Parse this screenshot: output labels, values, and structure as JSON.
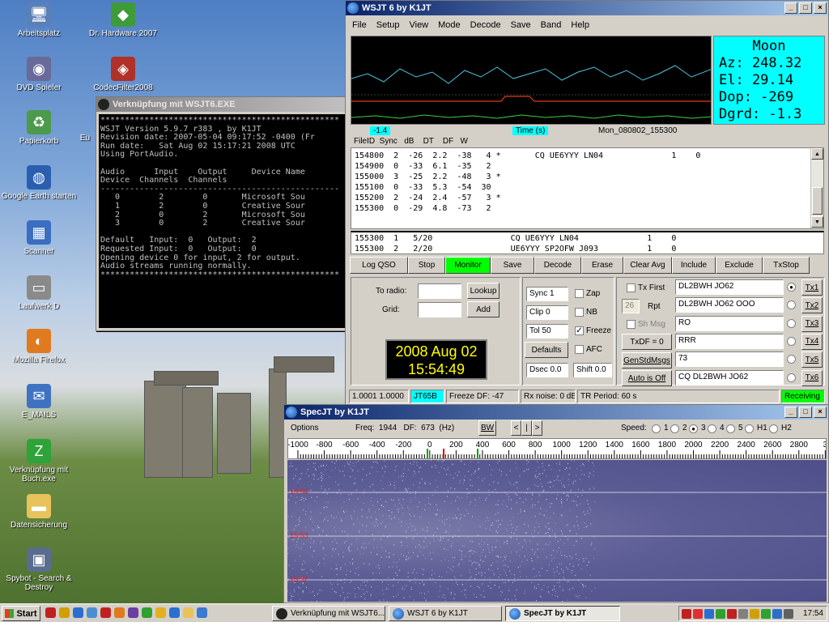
{
  "desktop_icons": [
    {
      "label": "Arbeitsplatz",
      "glyph": "🖥",
      "color": "#5b7fb8"
    },
    {
      "label": "DVD Spieler",
      "glyph": "◉",
      "color": "#6a6a9a"
    },
    {
      "label": "Papierkorb",
      "glyph": "♻",
      "color": "#4c9a4c"
    },
    {
      "label": "Google Earth starten",
      "glyph": "◍",
      "color": "#2a5fb0"
    },
    {
      "label": "Scanner",
      "glyph": "▦",
      "color": "#3b6dc0"
    },
    {
      "label": "Laufwerk D",
      "glyph": "▭",
      "color": "#8a8a8a"
    },
    {
      "label": "Mozilla Firefox",
      "glyph": "◐",
      "color": "#e07a1f"
    },
    {
      "label": "E_MAILS",
      "glyph": "✉",
      "color": "#3f73c2"
    },
    {
      "label": "Verknüpfung mit Buch.exe",
      "glyph": "Z",
      "color": "#2da33a"
    },
    {
      "label": "Datensicherung",
      "glyph": "▬",
      "color": "#e8c25a"
    },
    {
      "label": "Spybot - Search & Destroy",
      "glyph": "▣",
      "color": "#5a6d8e"
    },
    {
      "label": "Dr. Hardware 2007",
      "glyph": "◆",
      "color": "#3f9a3a"
    },
    {
      "label": "CodecFilter2008",
      "glyph": "◈",
      "color": "#b0302a"
    },
    {
      "label": "Eu",
      "glyph": "",
      "color": "transparent"
    }
  ],
  "console": {
    "title": "Verknüpfung mit WSJT6.EXE",
    "lines": [
      "*************************************************",
      "WSJT Version 5.9.7 r383 , by K1JT",
      "Revision date: 2007-05-04 09:17:52 -0400 (Fr",
      "Run date:   Sat Aug 02 15:17:21 2008 UTC",
      "Using PortAudio.",
      "",
      "Audio      Input    Output     Device Name",
      "Device  Channels  Channels",
      "-------------------------------------------------",
      "   0        2        0       Microsoft Sou",
      "   1        2        0       Creative Sour",
      "   2        0        2       Microsoft Sou",
      "   3        0        2       Creative Sour",
      "",
      "Default   Input:  0   Output:  2",
      "Requested Input:  0   Output:  0",
      "Opening device 0 for input, 2 for output.",
      "Audio streams running normally.",
      "*************************************************"
    ]
  },
  "wsjt": {
    "title": "WSJT 6    by K1JT",
    "menu": [
      "File",
      "Setup",
      "View",
      "Mode",
      "Decode",
      "Save",
      "Band",
      "Help"
    ],
    "moon": {
      "title": "Moon",
      "az": "Az: 248.32",
      "el": "El:  29.14",
      "dop": "Dop:  -269",
      "dgrd": "Dgrd: -1.3"
    },
    "graph_labels": {
      "left": "-1.4",
      "center": "Time (s)",
      "right": "Mon_080802_155300"
    },
    "columns": "FileID  Sync   dB    DT    DF   W",
    "rows": [
      "154800  2  -26  2.2  -38   4 *       CQ UE6YYY LN04              1    0",
      "154900  0  -33  6.1  -35   2",
      "155000  3  -25  2.2  -48   3 *",
      "155100  0  -33  5.3  -54  30",
      "155200  2  -24  2.4  -57   3 *",
      "155300  0  -29  4.8  -73   2"
    ],
    "avg_rows": [
      "155300  1   5/20                CQ UE6YYY LN04              1    0",
      "155300  2   2/20                UE6YYY SP2OFW J093          1    0"
    ],
    "buttons": [
      "Log QSO",
      "Stop",
      "Monitor",
      "Save",
      "Decode",
      "Erase",
      "Clear Avg",
      "Include",
      "Exclude",
      "TxStop"
    ],
    "to_radio_label": "To radio:",
    "grid_label": "Grid:",
    "lookup": "Lookup",
    "add": "Add",
    "date": "2008 Aug 02",
    "time": "15:54:49",
    "sync": "Sync  1",
    "clip": "Clip  0",
    "tol": "Tol   50",
    "defaults": "Defaults",
    "dsec": "Dsec  0.0",
    "shift": "Shift 0.0",
    "zap": "Zap",
    "nb": "NB",
    "freeze": "Freeze",
    "afc": "AFC",
    "tx_first": "Tx First",
    "rpt_value": "26",
    "rpt": "Rpt",
    "sh_msg": "Sh Msg",
    "txdf": "TxDF = 0",
    "genstd": "GenStdMsgs",
    "auto": "Auto is Off",
    "tx_msgs": [
      "DL2BWH JO62",
      "DL2BWH JO62 OOO",
      "RO",
      "RRR",
      "73",
      "CQ DL2BWH JO62"
    ],
    "tx_buttons": [
      "Tx1",
      "Tx2",
      "Tx3",
      "Tx4",
      "Tx5",
      "Tx6"
    ],
    "status": {
      "ratio": "1.0001 1.0000",
      "mode": "JT65B",
      "freeze": "Freeze DF: -47",
      "rx": "Rx noise:  0 dB",
      "tr": "TR Period: 60 s",
      "receiving": "Receiving"
    }
  },
  "specjt": {
    "title": "SpecJT    by K1JT",
    "options": "Options",
    "freq": "Freq:  1944   DF:  673  (Hz)",
    "bw": "BW",
    "nav": [
      "<",
      "|",
      ">"
    ],
    "speed_label": "Speed:",
    "speeds": [
      "1",
      "2",
      "3",
      "4",
      "5",
      "H1",
      "H2"
    ],
    "scale": [
      "-1000",
      "-800",
      "-600",
      "-400",
      "-200",
      "0",
      "200",
      "400",
      "600",
      "800",
      "1000",
      "1200",
      "1400",
      "1600",
      "1800",
      "2000",
      "2200",
      "2400",
      "2600",
      "2800",
      "3"
    ],
    "markers": [
      "15:54",
      "15:53",
      "15:52"
    ]
  },
  "taskbar": {
    "start": "Start",
    "tasks": [
      "Verknüpfung mit WSJT6....",
      "WSJT 6    by K1JT",
      "SpecJT    by K1JT"
    ],
    "clock": "17:54"
  }
}
